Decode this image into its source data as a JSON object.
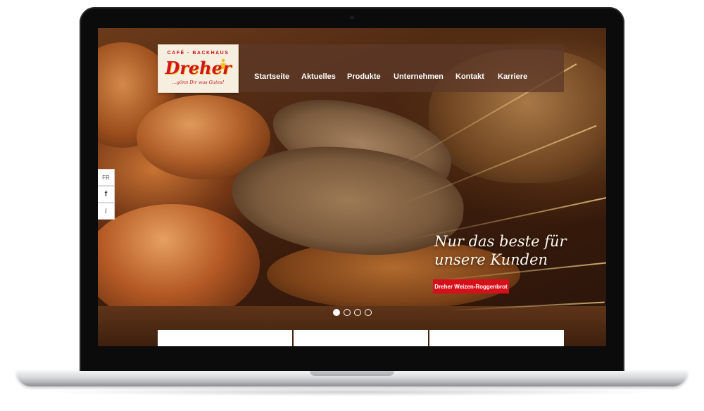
{
  "logo": {
    "top_line": "CAFÉ · BACKHAUS",
    "name": "Dreher",
    "tagline": "...gönn Dir was Gutes!"
  },
  "nav": {
    "items": [
      {
        "label": "Startseite"
      },
      {
        "label": "Aktuelles"
      },
      {
        "label": "Produkte"
      },
      {
        "label": "Unternehmen"
      },
      {
        "label": "Kontakt"
      },
      {
        "label": "Karriere"
      }
    ]
  },
  "social": {
    "lang": "FR",
    "facebook": "f",
    "info": "i"
  },
  "hero": {
    "headline_line1": "Nur das beste für",
    "headline_line2": "unsere Kunden",
    "cta_label": "Dreher Weizen-Roggenbrot",
    "slides_total": 4,
    "slide_active": 1
  },
  "colors": {
    "accent_red": "#d6101a",
    "nav_bg": "#5c3828"
  }
}
